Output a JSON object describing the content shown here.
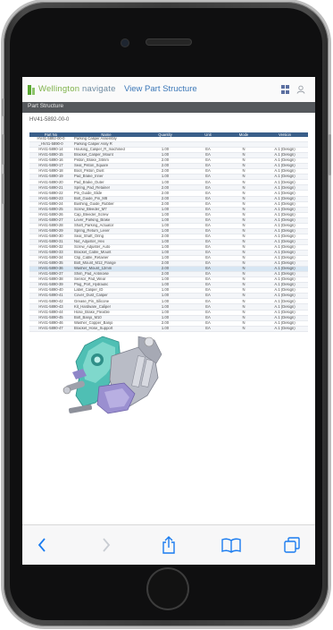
{
  "app": {
    "brand_company": "Wellington",
    "brand_app": "navigate",
    "page_title": "View Part Structure"
  },
  "breadcrumb": "Part Structure",
  "part_id": "HV41-5892-00-0",
  "table": {
    "columns": [
      "Part No",
      "Name",
      "Quantity",
      "Unit",
      "Mode",
      "Version"
    ],
    "rows": [
      {
        "part": "HV41-5892-00-0",
        "name": "Parking Caliper Assembly",
        "qty": "",
        "unit": "",
        "mode": "",
        "ver": ""
      },
      {
        "part": "_HV41-5890-0",
        "name": "Parking Caliper Assy R",
        "qty": "",
        "unit": "",
        "mode": "",
        "ver": ""
      },
      {
        "part": "HV41-5890-14",
        "name": "Housing_Caliper_R_machined",
        "qty": "1.00",
        "unit": "EA",
        "mode": "N",
        "ver": "A.1 (Design)"
      },
      {
        "part": "HV41-5890-15",
        "name": "Bracket_Caliper_Mount",
        "qty": "1.00",
        "unit": "EA",
        "mode": "N",
        "ver": "A.1 (Design)"
      },
      {
        "part": "HV41-5890-16",
        "name": "Piston_Brake_34mm",
        "qty": "2.00",
        "unit": "EA",
        "mode": "N",
        "ver": "A.1 (Design)"
      },
      {
        "part": "HV41-5890-17",
        "name": "Seal_Piston_Square",
        "qty": "2.00",
        "unit": "EA",
        "mode": "N",
        "ver": "A.1 (Design)"
      },
      {
        "part": "HV41-5890-18",
        "name": "Boot_Piston_Dust",
        "qty": "2.00",
        "unit": "EA",
        "mode": "N",
        "ver": "A.1 (Design)"
      },
      {
        "part": "HV41-5890-19",
        "name": "Pad_Brake_Inner",
        "qty": "1.00",
        "unit": "EA",
        "mode": "N",
        "ver": "A.1 (Design)"
      },
      {
        "part": "HV41-5890-20",
        "name": "Pad_Brake_Outer",
        "qty": "1.00",
        "unit": "EA",
        "mode": "N",
        "ver": "A.1 (Design)"
      },
      {
        "part": "HV41-5890-21",
        "name": "Spring_Pad_Retainer",
        "qty": "2.00",
        "unit": "EA",
        "mode": "N",
        "ver": "A.1 (Design)"
      },
      {
        "part": "HV41-5890-22",
        "name": "Pin_Guide_Slide",
        "qty": "2.00",
        "unit": "EA",
        "mode": "N",
        "ver": "A.1 (Design)"
      },
      {
        "part": "HV41-5890-23",
        "name": "Bolt_Guide_Pin_M8",
        "qty": "2.00",
        "unit": "EA",
        "mode": "N",
        "ver": "A.1 (Design)"
      },
      {
        "part": "HV41-5890-24",
        "name": "Bushing_Guide_Rubber",
        "qty": "2.00",
        "unit": "EA",
        "mode": "N",
        "ver": "A.1 (Design)"
      },
      {
        "part": "HV41-5890-25",
        "name": "Screw_Bleeder_M7",
        "qty": "1.00",
        "unit": "EA",
        "mode": "N",
        "ver": "A.1 (Design)"
      },
      {
        "part": "HV41-5890-26",
        "name": "Cap_Bleeder_Screw",
        "qty": "1.00",
        "unit": "EA",
        "mode": "N",
        "ver": "A.1 (Design)"
      },
      {
        "part": "HV41-5890-27",
        "name": "Lever_Parking_Brake",
        "qty": "1.00",
        "unit": "EA",
        "mode": "N",
        "ver": "A.1 (Design)"
      },
      {
        "part": "HV41-5890-28",
        "name": "Shaft_Parking_Actuator",
        "qty": "1.00",
        "unit": "EA",
        "mode": "N",
        "ver": "A.1 (Design)"
      },
      {
        "part": "HV41-5890-29",
        "name": "Spring_Return_Lever",
        "qty": "1.00",
        "unit": "EA",
        "mode": "N",
        "ver": "A.1 (Design)"
      },
      {
        "part": "HV41-5890-30",
        "name": "Seal_Shaft_Oring",
        "qty": "2.00",
        "unit": "EA",
        "mode": "N",
        "ver": "A.1 (Design)"
      },
      {
        "part": "HV41-5890-31",
        "name": "Nut_Adjuster_Hex",
        "qty": "1.00",
        "unit": "EA",
        "mode": "N",
        "ver": "A.1 (Design)"
      },
      {
        "part": "HV41-5890-32",
        "name": "Screw_Adjuster_Auto",
        "qty": "1.00",
        "unit": "EA",
        "mode": "N",
        "ver": "A.1 (Design)"
      },
      {
        "part": "HV41-5890-33",
        "name": "Bracket_Cable_Mount",
        "qty": "1.00",
        "unit": "EA",
        "mode": "N",
        "ver": "A.1 (Design)"
      },
      {
        "part": "HV41-5890-34",
        "name": "Clip_Cable_Retainer",
        "qty": "1.00",
        "unit": "EA",
        "mode": "N",
        "ver": "A.1 (Design)"
      },
      {
        "part": "HV41-5890-35",
        "name": "Bolt_Mount_M12_Flange",
        "qty": "2.00",
        "unit": "EA",
        "mode": "N",
        "ver": "A.1 (Design)"
      },
      {
        "part": "HV41-5890-36",
        "name": "Washer_Mount_12mm",
        "qty": "2.00",
        "unit": "EA",
        "mode": "N",
        "ver": "A.1 (Design)"
      },
      {
        "part": "HV41-5890-37",
        "name": "Shim_Pad_Antinoise",
        "qty": "2.00",
        "unit": "EA",
        "mode": "N",
        "ver": "A.1 (Design)"
      },
      {
        "part": "HV41-5890-38",
        "name": "Sensor_Pad_Wear",
        "qty": "1.00",
        "unit": "EA",
        "mode": "N",
        "ver": "A.1 (Design)"
      },
      {
        "part": "HV41-5890-39",
        "name": "Plug_Port_Hydraulic",
        "qty": "1.00",
        "unit": "EA",
        "mode": "N",
        "ver": "A.1 (Design)"
      },
      {
        "part": "HV41-5890-40",
        "name": "Label_Caliper_ID",
        "qty": "1.00",
        "unit": "EA",
        "mode": "N",
        "ver": "A.1 (Design)"
      },
      {
        "part": "HV41-5890-41",
        "name": "Cover_Dust_Caliper",
        "qty": "1.00",
        "unit": "EA",
        "mode": "N",
        "ver": "A.1 (Design)"
      },
      {
        "part": "HV41-5890-42",
        "name": "Grease_Pin_Silicone",
        "qty": "1.00",
        "unit": "EA",
        "mode": "N",
        "ver": "A.1 (Design)"
      },
      {
        "part": "HV41-5890-43",
        "name": "Kit_Hardware_Caliper",
        "qty": "1.00",
        "unit": "EA",
        "mode": "N",
        "ver": "A.1 (Design)"
      },
      {
        "part": "HV41-5890-44",
        "name": "Hose_Brake_Flexible",
        "qty": "1.00",
        "unit": "EA",
        "mode": "N",
        "ver": "A.1 (Design)"
      },
      {
        "part": "HV41-5890-45",
        "name": "Bolt_Banjo_M10",
        "qty": "1.00",
        "unit": "EA",
        "mode": "N",
        "ver": "A.1 (Design)"
      },
      {
        "part": "HV41-5890-46",
        "name": "Washer_Copper_Banjo",
        "qty": "2.00",
        "unit": "EA",
        "mode": "N",
        "ver": "A.1 (Design)"
      },
      {
        "part": "HV41-5890-47",
        "name": "Bracket_Hose_Support",
        "qty": "1.00",
        "unit": "EA",
        "mode": "N",
        "ver": "A.1 (Design)"
      }
    ],
    "selected_row": 24
  },
  "viewer": {
    "model_icon": "caliper-3d-model"
  },
  "toolbar": [
    {
      "name": "back-button",
      "icon": "chevron-left-icon",
      "enabled": true
    },
    {
      "name": "forward-button",
      "icon": "chevron-right-icon",
      "enabled": false
    },
    {
      "name": "share-button",
      "icon": "share-icon",
      "enabled": true
    },
    {
      "name": "bookmarks-button",
      "icon": "book-icon",
      "enabled": true
    },
    {
      "name": "tabs-button",
      "icon": "tabs-icon",
      "enabled": true
    }
  ],
  "colors": {
    "accent": "#3c78b8",
    "header": "#3a5f8a",
    "toolbar_icon": "#1a7cf0",
    "brand": "#7fb24a"
  }
}
